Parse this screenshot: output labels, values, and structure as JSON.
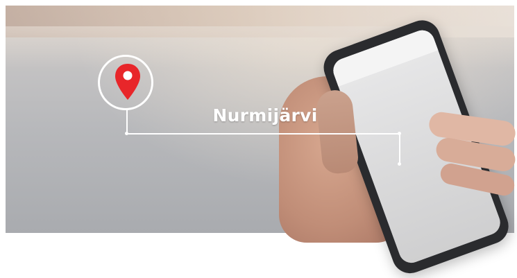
{
  "location": {
    "name": "Nurmijärvi",
    "pin_icon": "map-pin-icon",
    "pin_color": "#e8262a",
    "line_color": "#ffffff"
  }
}
